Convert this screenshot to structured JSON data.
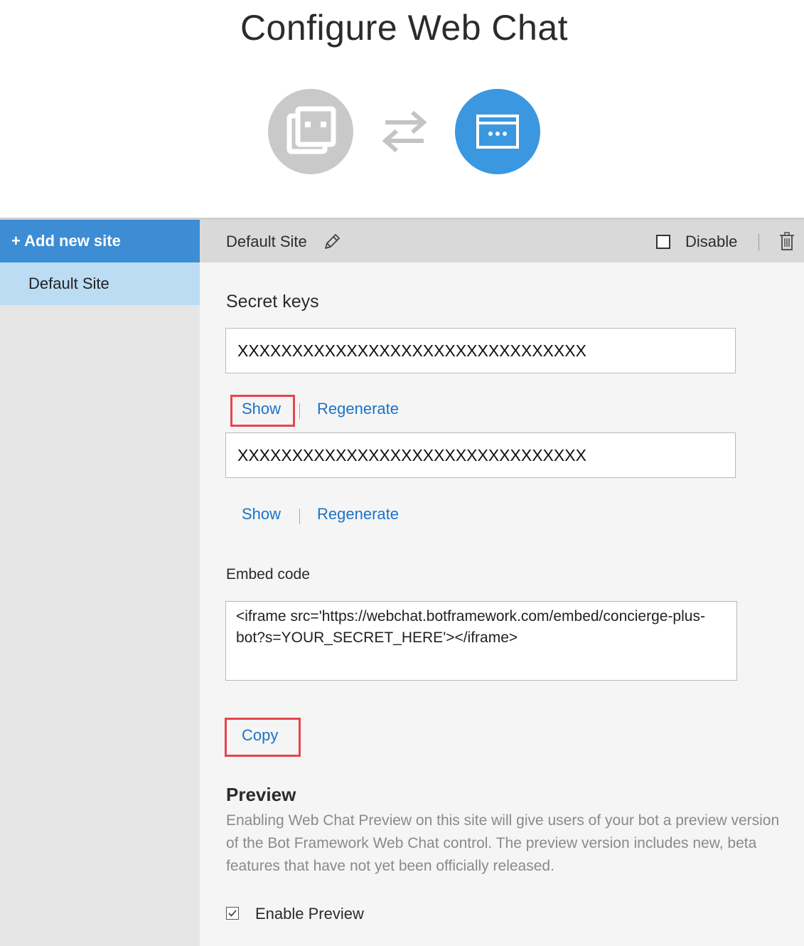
{
  "page": {
    "title": "Configure Web Chat"
  },
  "icons": {
    "bot": "bot-icon",
    "swap": "swap-arrows-icon",
    "webchat": "webchat-window-icon",
    "edit": "pencil-icon",
    "delete": "trash-icon",
    "check": "checkmark-icon"
  },
  "colors": {
    "accent": "#3c8dd3",
    "selected": "#bbdcf3",
    "link": "#1b73c7",
    "highlight": "#e8444c",
    "bot_circle": "#c9c9c9",
    "webchat_circle": "#3a97e0"
  },
  "sidebar": {
    "add_label": "+ Add new site",
    "sites": [
      {
        "label": "Default Site",
        "selected": true
      }
    ]
  },
  "site": {
    "name": "Default Site",
    "disable_label": "Disable",
    "disabled": false
  },
  "secret_keys": {
    "heading": "Secret keys",
    "keys": [
      {
        "value": "XXXXXXXXXXXXXXXXXXXXXXXXXXXXXXXX",
        "show_label": "Show",
        "regenerate_label": "Regenerate"
      },
      {
        "value": "XXXXXXXXXXXXXXXXXXXXXXXXXXXXXXXX",
        "show_label": "Show",
        "regenerate_label": "Regenerate"
      }
    ]
  },
  "embed": {
    "label": "Embed code",
    "code": "<iframe src='https://webchat.botframework.com/embed/concierge-plus-bot?s=YOUR_SECRET_HERE'></iframe>",
    "copy_label": "Copy"
  },
  "preview": {
    "heading": "Preview",
    "description": "Enabling Web Chat Preview on this site will give users of your bot a preview version of the Bot Framework Web Chat control. The preview version includes new, beta features that have not yet been officially released.",
    "enable_label": "Enable Preview",
    "enabled": true
  }
}
